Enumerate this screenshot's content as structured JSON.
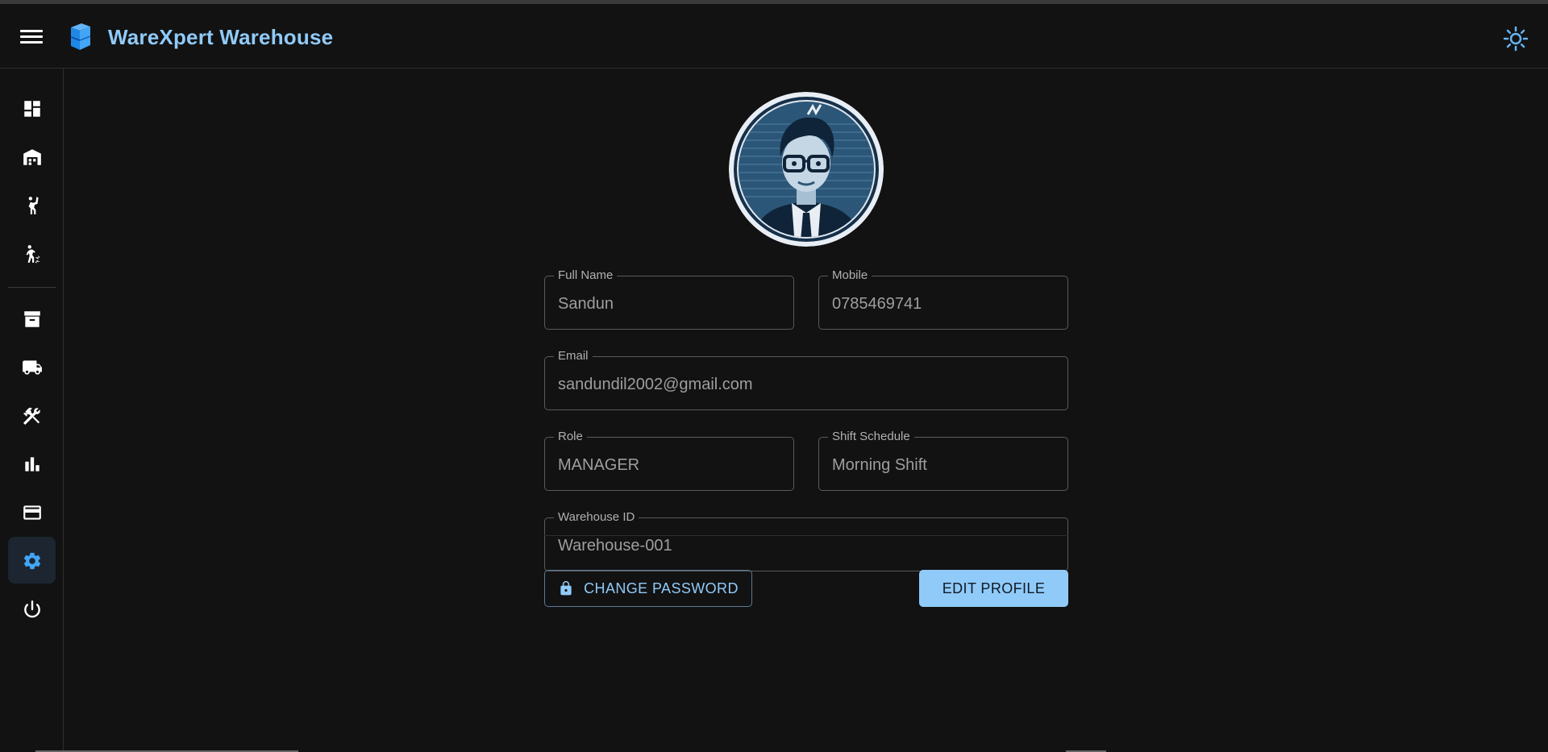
{
  "app": {
    "title": "WareXpert Warehouse"
  },
  "colors": {
    "accent": "#90caf9",
    "background": "#121212",
    "active_nav": "#1c2530"
  },
  "header": {
    "menu_icon": "menu-icon",
    "logo_icon": "cube-logo-icon",
    "theme_icon": "sun-icon"
  },
  "sidebar": {
    "items": [
      {
        "icon": "dashboard-icon"
      },
      {
        "icon": "warehouse-icon"
      },
      {
        "icon": "person-raising-hand-icon"
      },
      {
        "icon": "person-transfer-icon"
      },
      {
        "icon": "inventory-box-icon"
      },
      {
        "icon": "truck-icon"
      },
      {
        "icon": "tools-icon"
      },
      {
        "icon": "bar-chart-icon"
      },
      {
        "icon": "credit-card-icon"
      },
      {
        "icon": "settings-icon",
        "active": true
      },
      {
        "icon": "power-icon"
      }
    ]
  },
  "profile": {
    "avatar": "avatar-illustration",
    "full_name": {
      "label": "Full Name",
      "value": "Sandun"
    },
    "mobile": {
      "label": "Mobile",
      "value": "0785469741"
    },
    "email": {
      "label": "Email",
      "value": "sandundil2002@gmail.com"
    },
    "role": {
      "label": "Role",
      "value": "MANAGER"
    },
    "shift": {
      "label": "Shift Schedule",
      "value": "Morning Shift"
    },
    "warehouse": {
      "label": "Warehouse ID",
      "value": "Warehouse-001"
    }
  },
  "actions": {
    "change_password": "CHANGE PASSWORD",
    "change_password_icon": "lock-icon",
    "edit_profile": "EDIT PROFILE"
  }
}
